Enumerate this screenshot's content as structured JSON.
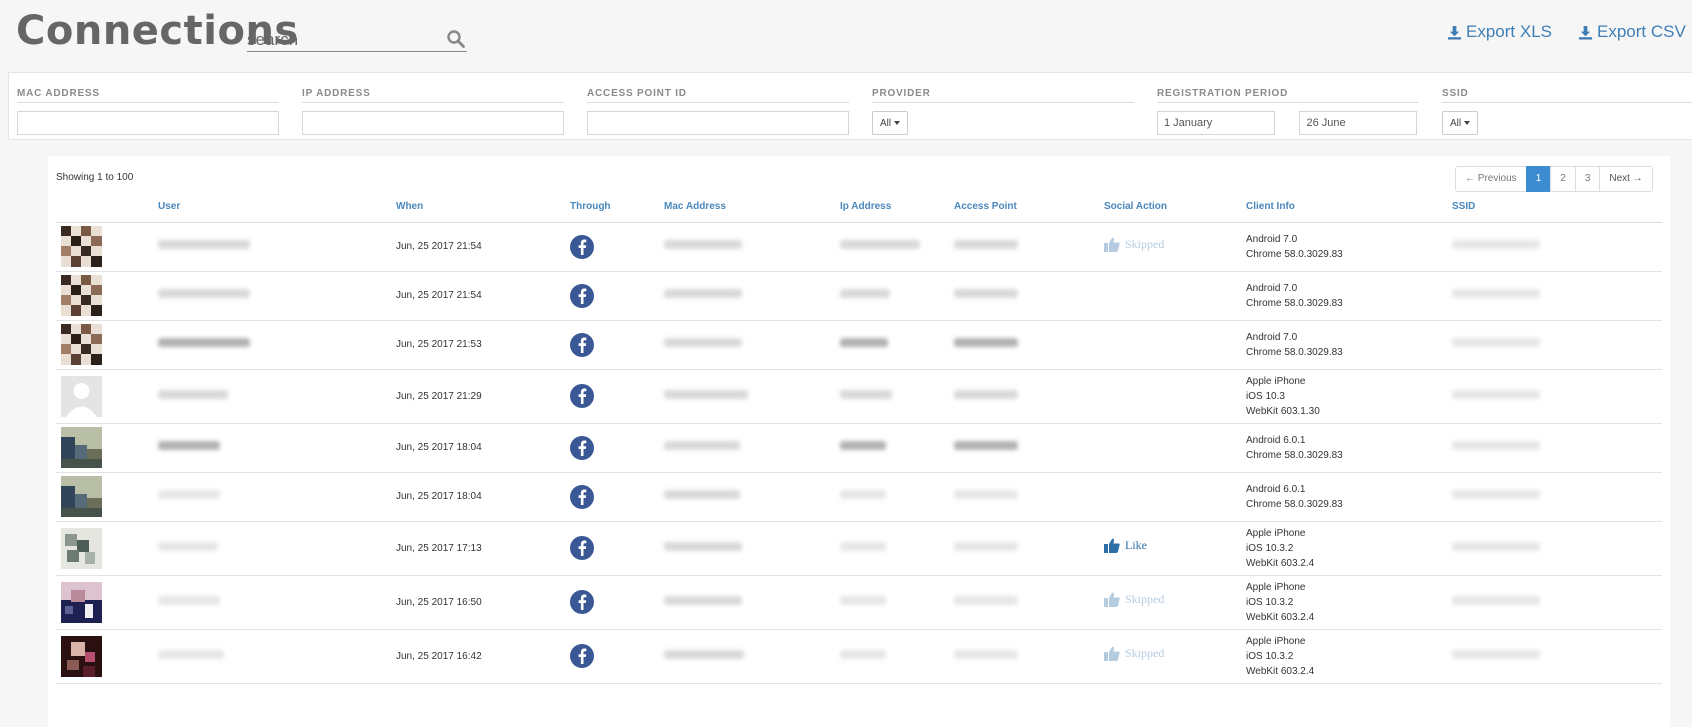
{
  "header": {
    "title": "Connections",
    "search_placeholder": "search",
    "export_xls": "Export XLS",
    "export_csv": "Export CSV"
  },
  "filters": {
    "mac_address": {
      "label": "MAC ADDRESS",
      "value": ""
    },
    "ip_address": {
      "label": "IP ADDRESS",
      "value": ""
    },
    "access_point_id": {
      "label": "ACCESS POINT ID",
      "value": ""
    },
    "provider": {
      "label": "PROVIDER",
      "selected": "All"
    },
    "registration_period": {
      "label": "REGISTRATION PERIOD",
      "from": "1 January",
      "to": "26 June"
    },
    "ssid": {
      "label": "SSID",
      "selected": "All"
    }
  },
  "table": {
    "showing": "Showing 1 to 100",
    "pagination": {
      "previous": "← Previous",
      "pages": [
        "1",
        "2",
        "3"
      ],
      "active_page": "1",
      "next": "Next →"
    },
    "columns": [
      "User",
      "When",
      "Through",
      "Mac Address",
      "Ip Address",
      "Access Point",
      "Social Action",
      "Client Info",
      "SSID"
    ],
    "rows": [
      {
        "when": "Jun, 25 2017 21:54",
        "social": "Skipped",
        "client": [
          "Android 7.0",
          "Chrome 58.0.3029.83"
        ],
        "avatar": "a"
      },
      {
        "when": "Jun, 25 2017 21:54",
        "social": "",
        "client": [
          "Android 7.0",
          "Chrome 58.0.3029.83"
        ],
        "avatar": "a"
      },
      {
        "when": "Jun, 25 2017 21:53",
        "social": "",
        "client": [
          "Android 7.0",
          "Chrome 58.0.3029.83"
        ],
        "avatar": "a"
      },
      {
        "when": "Jun, 25 2017 21:29",
        "social": "",
        "client": [
          "Apple iPhone",
          "iOS 10.3",
          "WebKit 603.1.30"
        ],
        "avatar": "default"
      },
      {
        "when": "Jun, 25 2017 18:04",
        "social": "",
        "client": [
          "Android 6.0.1",
          "Chrome 58.0.3029.83"
        ],
        "avatar": "b"
      },
      {
        "when": "Jun, 25 2017 18:04",
        "social": "",
        "client": [
          "Android 6.0.1",
          "Chrome 58.0.3029.83"
        ],
        "avatar": "b"
      },
      {
        "when": "Jun, 25 2017 17:13",
        "social": "Like",
        "client": [
          "Apple iPhone",
          "iOS 10.3.2",
          "WebKit 603.2.4"
        ],
        "avatar": "c"
      },
      {
        "when": "Jun, 25 2017 16:50",
        "social": "Skipped",
        "client": [
          "Apple iPhone",
          "iOS 10.3.2",
          "WebKit 603.2.4"
        ],
        "avatar": "d"
      },
      {
        "when": "Jun, 25 2017 16:42",
        "social": "Skipped",
        "client": [
          "Apple iPhone",
          "iOS 10.3.2",
          "WebKit 603.2.4"
        ],
        "avatar": "e"
      }
    ]
  },
  "icons": {
    "search": "search-icon",
    "download": "download-icon",
    "facebook": "facebook-icon",
    "thumbs_up": "thumbs-up-icon",
    "caret": "caret-down-icon"
  },
  "colors": {
    "accent": "#3f7fb6",
    "active_page": "#3d8bd0",
    "facebook": "#3a5796",
    "skipped": "#b5cce0"
  }
}
